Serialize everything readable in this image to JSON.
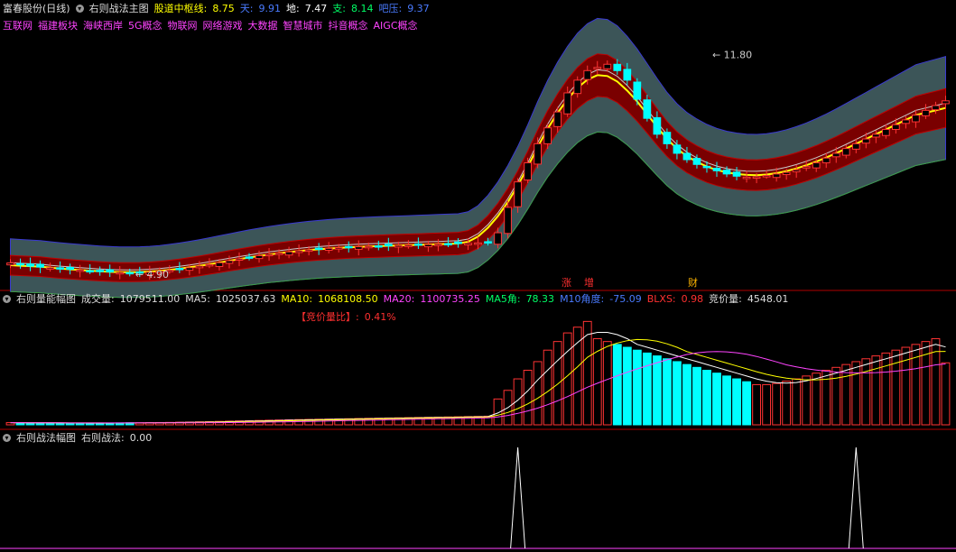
{
  "header": {
    "stock": "富春股份(日线)",
    "panel_name": "右则战法主图",
    "pivot_label": "股道中枢线:",
    "pivot_value": "8.75",
    "sky_label": "天:",
    "sky_value": "9.91",
    "ground_label": "地:",
    "ground_value": "7.47",
    "support_label": "支:",
    "support_value": "8.14",
    "pressure_label": "吧压:",
    "pressure_value": "9.37"
  },
  "concepts": [
    "互联网",
    "福建板块",
    "海峡西岸",
    "5G概念",
    "物联网",
    "网络游戏",
    "大数据",
    "智慧城市",
    "抖音概念",
    "AIGC概念"
  ],
  "markers": {
    "zhang": "涨",
    "zeng": "增",
    "cai": "财"
  },
  "volume_panel": {
    "name": "右则量能幅图",
    "vol_label": "成交量:",
    "vol_value": "1079511.00",
    "ma5_label": "MA5:",
    "ma5_value": "1025037.63",
    "ma10_label": "MA10:",
    "ma10_value": "1068108.50",
    "ma20_label": "MA20:",
    "ma20_value": "1100735.25",
    "ma5a_label": "MA5角:",
    "ma5a_value": "78.33",
    "ma10a_label": "M10角度:",
    "ma10a_value": "-75.09",
    "blxs_label": "BLXS:",
    "blxs_value": "0.98",
    "bid_label": "竞价量:",
    "bid_value": "4548.01",
    "ratio_label": "【竞价量比】:",
    "ratio_value": "0.41%"
  },
  "strategy_panel": {
    "name": "右则战法幅图",
    "label": "右则战法:",
    "value": "0.00"
  },
  "colors": {
    "up": "#ff3333",
    "down": "#00ffff",
    "pivot_line": "#ffff00",
    "band_outer": "#3c5558",
    "band_inner": "#7a0000",
    "magenta": "#ff44ff"
  },
  "chart_data": {
    "type": "candlestick",
    "n_bars": 95,
    "price_annotations": [
      {
        "label": "11.80",
        "bar": 70,
        "value": 11.8
      },
      {
        "label": "4.90",
        "bar": 12,
        "value": 4.9
      }
    ],
    "close": [
      5.25,
      5.2,
      5.15,
      5.12,
      5.1,
      5.07,
      5.05,
      5.03,
      5.0,
      4.98,
      4.97,
      4.95,
      4.93,
      4.94,
      4.96,
      4.99,
      5.02,
      5.06,
      5.1,
      5.15,
      5.2,
      5.26,
      5.32,
      5.38,
      5.43,
      5.48,
      5.52,
      5.56,
      5.6,
      5.63,
      5.66,
      5.69,
      5.71,
      5.73,
      5.74,
      5.76,
      5.77,
      5.78,
      5.79,
      5.8,
      5.81,
      5.82,
      5.83,
      5.84,
      5.85,
      5.86,
      5.87,
      5.88,
      5.9,
      6.2,
      7.0,
      7.8,
      8.4,
      9.0,
      9.5,
      10.0,
      10.6,
      11.0,
      11.3,
      11.4,
      11.5,
      11.3,
      11.0,
      10.4,
      9.8,
      9.3,
      9.0,
      8.7,
      8.5,
      8.35,
      8.25,
      8.15,
      8.05,
      7.98,
      7.95,
      7.96,
      8.0,
      8.05,
      8.1,
      8.18,
      8.28,
      8.4,
      8.55,
      8.7,
      8.85,
      9.0,
      9.15,
      9.3,
      9.45,
      9.6,
      9.75,
      9.9,
      10.05,
      10.2,
      10.35
    ],
    "volume": [
      38000,
      36000,
      34000,
      33000,
      32000,
      31000,
      30000,
      29000,
      30000,
      31000,
      32000,
      33000,
      35000,
      36000,
      38000,
      40000,
      42000,
      45000,
      48000,
      52000,
      56000,
      60000,
      64000,
      68000,
      72000,
      76000,
      80000,
      84000,
      88000,
      91000,
      94000,
      97000,
      100000,
      103000,
      106000,
      110000,
      113000,
      116000,
      119000,
      122000,
      125000,
      128000,
      131000,
      134000,
      137000,
      140000,
      143000,
      146000,
      150000,
      450000,
      600000,
      800000,
      950000,
      1100000,
      1300000,
      1450000,
      1600000,
      1700000,
      1800000,
      1500000,
      1450000,
      1400000,
      1350000,
      1300000,
      1250000,
      1200000,
      1150000,
      1100000,
      1050000,
      1000000,
      950000,
      900000,
      850000,
      800000,
      750000,
      700000,
      700000,
      720000,
      760000,
      800000,
      850000,
      900000,
      950000,
      1000000,
      1050000,
      1100000,
      1150000,
      1200000,
      1250000,
      1300000,
      1350000,
      1400000,
      1450000,
      1500000,
      1079511
    ],
    "strategy_signal_bars": [
      51,
      85
    ],
    "ylim_price": [
      4.5,
      12.5
    ]
  }
}
